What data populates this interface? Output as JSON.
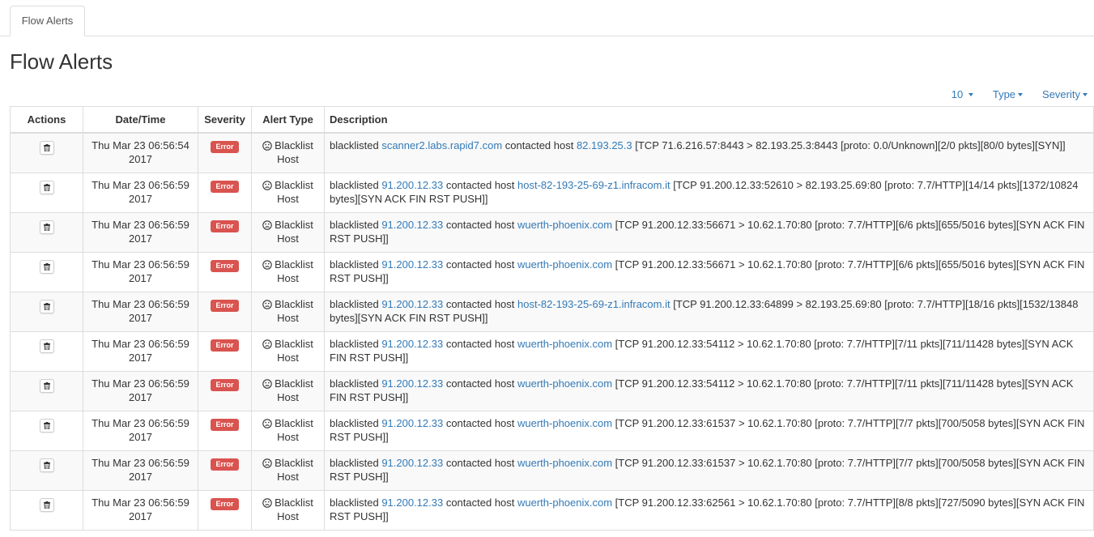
{
  "tabs": [
    {
      "label": "Flow Alerts"
    }
  ],
  "page": {
    "title": "Flow Alerts"
  },
  "toolbar": {
    "page_size": "10",
    "type_label": "Type",
    "severity_label": "Severity"
  },
  "colors": {
    "link": "#337ab7",
    "error_badge": "#d9534f",
    "border": "#dddddd"
  },
  "table": {
    "columns": [
      "Actions",
      "Date/Time",
      "Severity",
      "Alert Type",
      "Description"
    ],
    "rows": [
      {
        "datetime": "Thu Mar 23 06:56:54 2017",
        "severity": "Error",
        "alert_type": "Blacklist Host",
        "desc_prefix": "blacklisted ",
        "src": "scanner2.labs.rapid7.com",
        "mid": " contacted host ",
        "dst": "82.193.25.3",
        "details": " [TCP 71.6.216.57:8443 > 82.193.25.3:8443 [proto: 0.0/Unknown][2/0 pkts][80/0 bytes][SYN]]"
      },
      {
        "datetime": "Thu Mar 23 06:56:59 2017",
        "severity": "Error",
        "alert_type": "Blacklist Host",
        "desc_prefix": "blacklisted ",
        "src": "91.200.12.33",
        "mid": " contacted host ",
        "dst": "host-82-193-25-69-z1.infracom.it",
        "details": " [TCP 91.200.12.33:52610 > 82.193.25.69:80 [proto: 7.7/HTTP][14/14 pkts][1372/10824 bytes][SYN ACK FIN RST PUSH]]"
      },
      {
        "datetime": "Thu Mar 23 06:56:59 2017",
        "severity": "Error",
        "alert_type": "Blacklist Host",
        "desc_prefix": "blacklisted ",
        "src": "91.200.12.33",
        "mid": " contacted host ",
        "dst": "wuerth-phoenix.com",
        "details": " [TCP 91.200.12.33:56671 > 10.62.1.70:80 [proto: 7.7/HTTP][6/6 pkts][655/5016 bytes][SYN ACK FIN RST PUSH]]"
      },
      {
        "datetime": "Thu Mar 23 06:56:59 2017",
        "severity": "Error",
        "alert_type": "Blacklist Host",
        "desc_prefix": "blacklisted ",
        "src": "91.200.12.33",
        "mid": " contacted host ",
        "dst": "wuerth-phoenix.com",
        "details": " [TCP 91.200.12.33:56671 > 10.62.1.70:80 [proto: 7.7/HTTP][6/6 pkts][655/5016 bytes][SYN ACK FIN RST PUSH]]"
      },
      {
        "datetime": "Thu Mar 23 06:56:59 2017",
        "severity": "Error",
        "alert_type": "Blacklist Host",
        "desc_prefix": "blacklisted ",
        "src": "91.200.12.33",
        "mid": " contacted host ",
        "dst": "host-82-193-25-69-z1.infracom.it",
        "details": " [TCP 91.200.12.33:64899 > 82.193.25.69:80 [proto: 7.7/HTTP][18/16 pkts][1532/13848 bytes][SYN ACK FIN RST PUSH]]"
      },
      {
        "datetime": "Thu Mar 23 06:56:59 2017",
        "severity": "Error",
        "alert_type": "Blacklist Host",
        "desc_prefix": "blacklisted ",
        "src": "91.200.12.33",
        "mid": " contacted host ",
        "dst": "wuerth-phoenix.com",
        "details": " [TCP 91.200.12.33:54112 > 10.62.1.70:80 [proto: 7.7/HTTP][7/11 pkts][711/11428 bytes][SYN ACK FIN RST PUSH]]"
      },
      {
        "datetime": "Thu Mar 23 06:56:59 2017",
        "severity": "Error",
        "alert_type": "Blacklist Host",
        "desc_prefix": "blacklisted ",
        "src": "91.200.12.33",
        "mid": " contacted host ",
        "dst": "wuerth-phoenix.com",
        "details": " [TCP 91.200.12.33:54112 > 10.62.1.70:80 [proto: 7.7/HTTP][7/11 pkts][711/11428 bytes][SYN ACK FIN RST PUSH]]"
      },
      {
        "datetime": "Thu Mar 23 06:56:59 2017",
        "severity": "Error",
        "alert_type": "Blacklist Host",
        "desc_prefix": "blacklisted ",
        "src": "91.200.12.33",
        "mid": " contacted host ",
        "dst": "wuerth-phoenix.com",
        "details": " [TCP 91.200.12.33:61537 > 10.62.1.70:80 [proto: 7.7/HTTP][7/7 pkts][700/5058 bytes][SYN ACK FIN RST PUSH]]"
      },
      {
        "datetime": "Thu Mar 23 06:56:59 2017",
        "severity": "Error",
        "alert_type": "Blacklist Host",
        "desc_prefix": "blacklisted ",
        "src": "91.200.12.33",
        "mid": " contacted host ",
        "dst": "wuerth-phoenix.com",
        "details": " [TCP 91.200.12.33:61537 > 10.62.1.70:80 [proto: 7.7/HTTP][7/7 pkts][700/5058 bytes][SYN ACK FIN RST PUSH]]"
      },
      {
        "datetime": "Thu Mar 23 06:56:59 2017",
        "severity": "Error",
        "alert_type": "Blacklist Host",
        "desc_prefix": "blacklisted ",
        "src": "91.200.12.33",
        "mid": " contacted host ",
        "dst": "wuerth-phoenix.com",
        "details": " [TCP 91.200.12.33:62561 > 10.62.1.70:80 [proto: 7.7/HTTP][8/8 pkts][727/5090 bytes][SYN ACK FIN RST PUSH]]"
      }
    ]
  }
}
